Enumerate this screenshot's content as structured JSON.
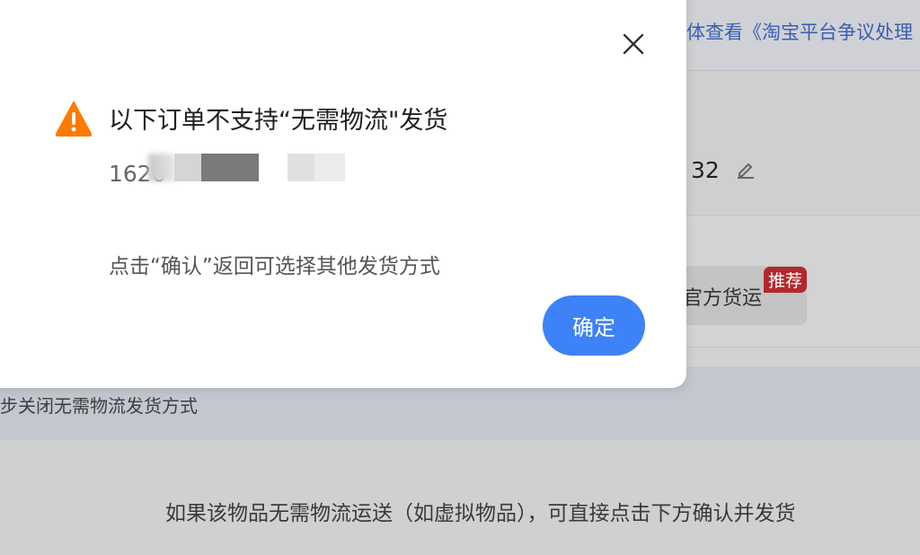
{
  "background": {
    "top_link": "体查看《淘宝平台争议处理",
    "order_number_tail": "32",
    "shipping_option_label": "官方货运",
    "recommend_badge": "推荐",
    "hint_text": "步关闭无需物流发货方式",
    "bottom_text": "如果该物品无需物流运送（如虚拟物品），可直接点击下方确认并发货"
  },
  "modal": {
    "title": "以下订单不支持“无需物流\"发货",
    "order_number": "1626",
    "description": "点击“确认”返回可选择其他发货方式",
    "confirm_label": "确定"
  },
  "icons": {
    "warning": "warning-icon",
    "close": "close-icon",
    "edit": "edit-icon"
  },
  "colors": {
    "primary": "#3e82f7",
    "warning": "#ff7a00",
    "badge": "#b3282d"
  }
}
